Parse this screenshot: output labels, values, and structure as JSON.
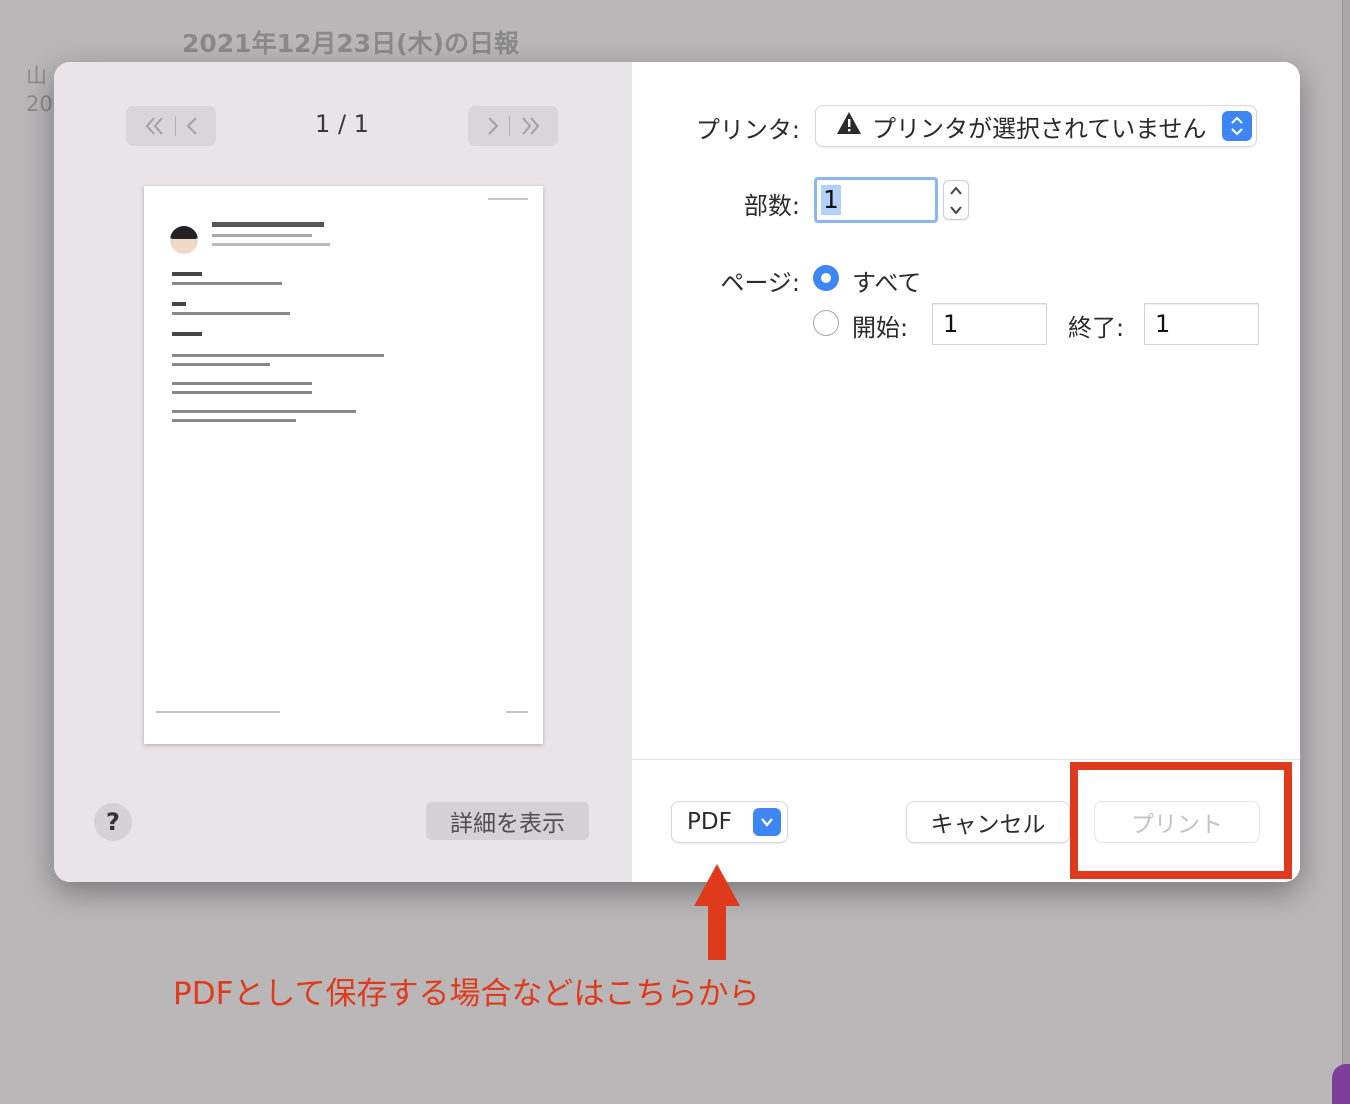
{
  "background": {
    "title": "2021年12月23日(木)の日報",
    "line1": "山",
    "line2": "20"
  },
  "preview_nav": {
    "page_counter": "1 / 1",
    "first_icon": "double-chevron-left-icon",
    "prev_icon": "chevron-left-icon",
    "next_icon": "chevron-right-icon",
    "last_icon": "double-chevron-right-icon"
  },
  "left_footer": {
    "help_label": "?",
    "details_label": "詳細を表示"
  },
  "printer": {
    "label": "プリンタ:",
    "value": "プリンタが選択されていません",
    "warning_icon": "warning-triangle-icon"
  },
  "copies": {
    "label": "部数:",
    "value": "1"
  },
  "pages": {
    "label": "ページ:",
    "all_label": "すべて",
    "range_start_label": "開始:",
    "range_start_value": "1",
    "range_end_label": "終了:",
    "range_end_value": "1",
    "selected": "all"
  },
  "footer": {
    "pdf_label": "PDF",
    "cancel_label": "キャンセル",
    "print_label": "プリント"
  },
  "annotation": {
    "note": "PDFとして保存する場合などはこちらから",
    "color": "#e03a1d"
  }
}
